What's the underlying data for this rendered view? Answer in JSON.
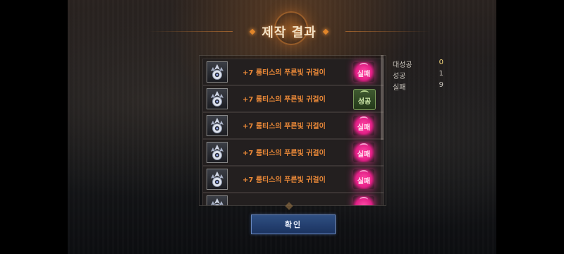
{
  "title": "제작 결과",
  "items": [
    {
      "name": "+7 룸티스의 푸른빛 귀걸이",
      "result": "fail",
      "label": "실패"
    },
    {
      "name": "+7 룸티스의 푸른빛 귀걸이",
      "result": "success",
      "label": "성공"
    },
    {
      "name": "+7 룸티스의 푸른빛 귀걸이",
      "result": "fail",
      "label": "실패"
    },
    {
      "name": "+7 룸티스의 푸른빛 귀걸이",
      "result": "fail",
      "label": "실패"
    },
    {
      "name": "+7 룸티스의 푸른빛 귀걸이",
      "result": "fail",
      "label": "실패"
    },
    {
      "name": "",
      "result": "fail",
      "label": ""
    }
  ],
  "stats": [
    {
      "label": "대성공",
      "value": "0",
      "color": "#f1d37a"
    },
    {
      "label": "성공",
      "value": "1",
      "color": "#c9c4bc"
    },
    {
      "label": "실패",
      "value": "9",
      "color": "#c9c4bc"
    }
  ],
  "confirm_label": "확인",
  "icon": "earring-icon"
}
